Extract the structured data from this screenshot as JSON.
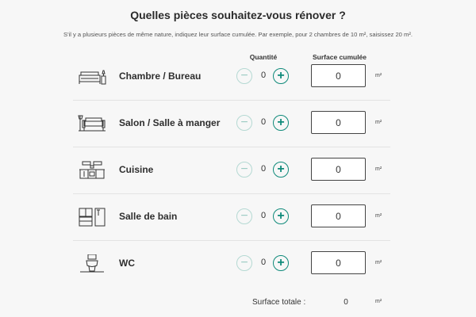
{
  "title": "Quelles pièces souhaitez-vous rénover ?",
  "subtitle": "S'il y a plusieurs pièces de même nature, indiquez leur surface cumulée. Par exemple, pour 2 chambres de 10 m², saisissez 20 m².",
  "columns": {
    "quantity": "Quantité",
    "surface": "Surface cumulée"
  },
  "buttons": {
    "minus": "−",
    "plus": "+"
  },
  "rooms": [
    {
      "label": "Chambre / Bureau",
      "icon": "bed-icon",
      "quantity": "0",
      "surface": "0",
      "unit": "m²"
    },
    {
      "label": "Salon / Salle à manger",
      "icon": "sofa-icon",
      "quantity": "0",
      "surface": "0",
      "unit": "m²"
    },
    {
      "label": "Cuisine",
      "icon": "kitchen-icon",
      "quantity": "0",
      "surface": "0",
      "unit": "m²"
    },
    {
      "label": "Salle de bain",
      "icon": "bathroom-icon",
      "quantity": "0",
      "surface": "0",
      "unit": "m²"
    },
    {
      "label": "WC",
      "icon": "toilet-icon",
      "quantity": "0",
      "surface": "0",
      "unit": "m²"
    }
  ],
  "total": {
    "label": "Surface totale :",
    "value": "0",
    "unit": "m²"
  },
  "colors": {
    "accent": "#0f8a7a",
    "accent_light": "#9ccbc3",
    "divider": "#e3e3e3",
    "background": "#f7f7f7"
  }
}
